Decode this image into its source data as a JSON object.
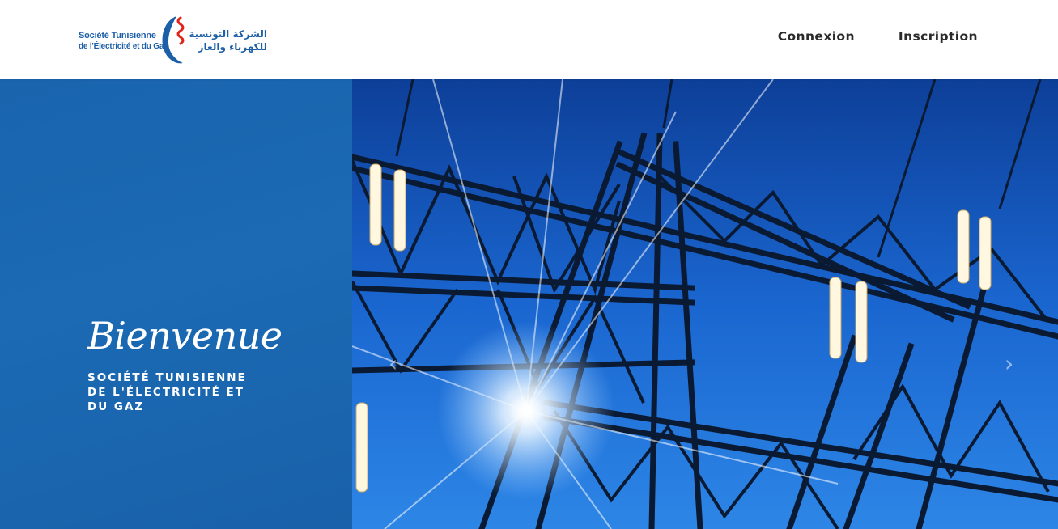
{
  "header": {
    "logo": {
      "name_fr_line1": "Société Tunisienne",
      "name_fr_line2": "de l'Électricité et du Gaz",
      "name_ar_line1": "الشركة التونسية",
      "name_ar_line2": "للكهرباء والغاز",
      "brand_color": "#1c5fa6",
      "accent_color": "#e2231a"
    },
    "nav": [
      {
        "label": "Connexion"
      },
      {
        "label": "Inscription"
      }
    ]
  },
  "hero": {
    "welcome": "Bienvenue",
    "company": "SOCIÉTÉ TUNISIENNE DE L'ÉLECTRICITÉ ET DU GAZ",
    "panel_color": "#1a64ae",
    "image_icon": "electricity-pylon-image",
    "prev_icon": "chevron-left-icon",
    "next_icon": "chevron-right-icon"
  }
}
